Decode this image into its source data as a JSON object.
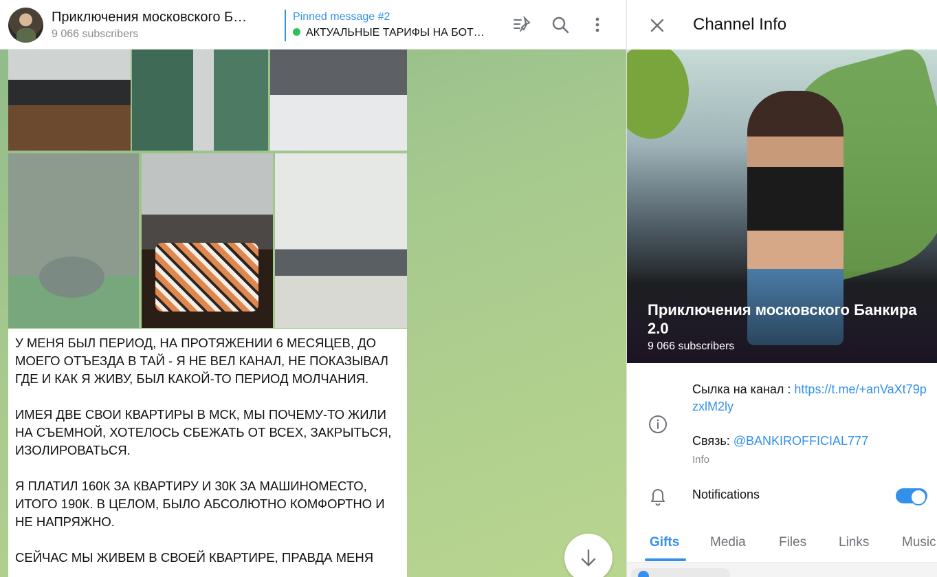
{
  "chat": {
    "title": "Приключения московского Б…",
    "subscribers": "9 066 subscribers",
    "pinned": {
      "title": "Pinned message #2",
      "text": "АКТУАЛЬНЫЕ ТАРИФЫ НА БОТ…"
    },
    "message": [
      "У МЕНЯ БЫЛ ПЕРИОД, НА ПРОТЯЖЕНИИ 6 МЕСЯЦЕВ, ДО МОЕГО ОТЪЕЗДА В ТАЙ - Я НЕ ВЕЛ КАНАЛ, НЕ ПОКАЗЫВАЛ ГДЕ И КАК Я ЖИВУ, БЫЛ КАКОЙ-ТО ПЕРИОД МОЛЧАНИЯ.",
      "ИМЕЯ ДВЕ СВОИ КВАРТИРЫ В МСК, МЫ ПОЧЕМУ-ТО ЖИЛИ НА СЪЕМНОЙ, ХОТЕЛОСЬ СБЕЖАТЬ ОТ ВСЕХ, ЗАКРЫТЬСЯ, ИЗОЛИРОВАТЬСЯ.",
      "Я ПЛАТИЛ 160К ЗА КВАРТИРУ И 30К ЗА МАШИНОМЕСТО, ИТОГО 190К. В ЦЕЛОМ, БЫЛО АБСОЛЮТНО КОМФОРТНО И НЕ НАПРЯЖНО.",
      "СЕЙЧАС МЫ ЖИВЕМ В СВОЕЙ КВАРТИРЕ, ПРАВДА МЕНЯ"
    ]
  },
  "info": {
    "header_title": "Channel Info",
    "cover_name": "Приключения московского Банкира 2.0",
    "cover_subscribers": "9 066 subscribers",
    "description_prefix": "Cылка на канал : ",
    "description_link": "https://t.me/+anVaXt79pzxlM2ly",
    "contact_prefix": "Связь: ",
    "contact_link": "@BANKIROFFICIAL777",
    "info_label": "Info",
    "notifications_label": "Notifications",
    "notifications_on": true,
    "tabs": [
      "Gifts",
      "Media",
      "Files",
      "Links",
      "Music"
    ],
    "active_tab": "Gifts"
  },
  "icons": {
    "pin": "unpin-icon",
    "search": "search-icon",
    "more": "more-vertical-icon",
    "close": "close-icon",
    "info": "info-circle-icon",
    "bell": "bell-icon",
    "arrow_down": "arrow-down-icon"
  },
  "colors": {
    "accent": "#3390ec",
    "online": "#2fbf5b"
  }
}
